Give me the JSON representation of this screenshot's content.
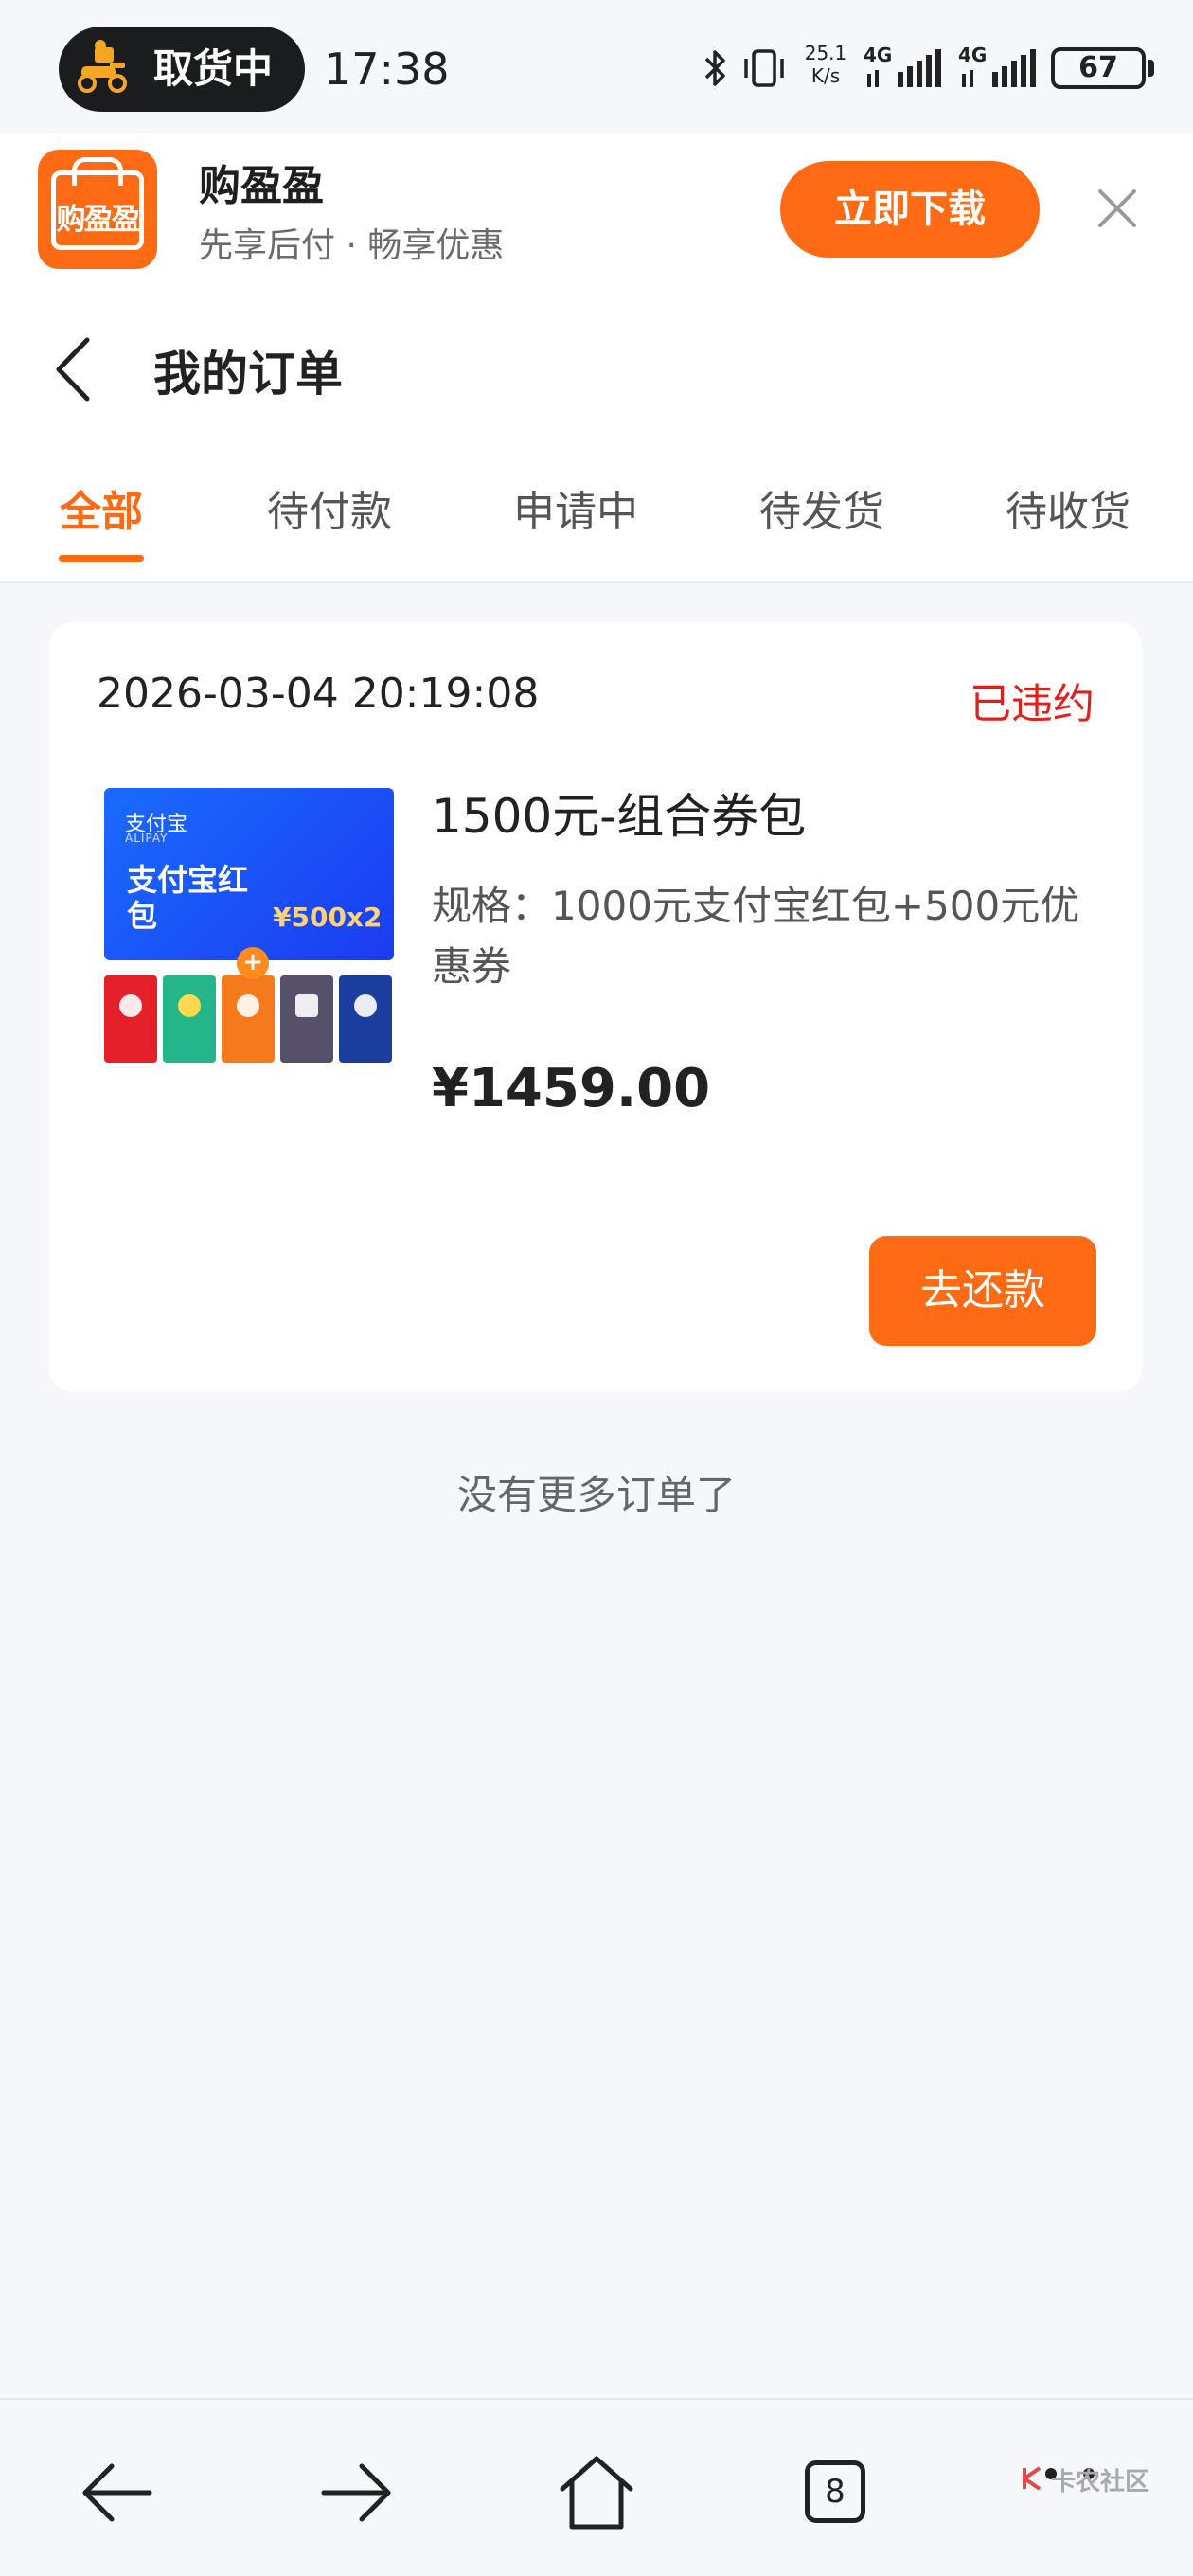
{
  "status_bar": {
    "pill_text": "取货中",
    "time": "17:38",
    "net_speed_value": "25.1",
    "net_speed_unit": "K/s",
    "signal_1_label": "4G",
    "signal_2_label": "4G",
    "battery_level": "67"
  },
  "promo": {
    "logo_text": "购盈盈",
    "app_name": "购盈盈",
    "slogan": "先享后付 · 畅享优惠",
    "download_label": "立即下载"
  },
  "header": {
    "title": "我的订单"
  },
  "tabs": [
    {
      "label": "全部",
      "active": true
    },
    {
      "label": "待付款",
      "active": false
    },
    {
      "label": "申请中",
      "active": false
    },
    {
      "label": "待发货",
      "active": false
    },
    {
      "label": "待收货",
      "active": false
    }
  ],
  "order": {
    "time": "2026-03-04 20:19:08",
    "status": "已违约",
    "thumbnail": {
      "brand": "支付宝",
      "brand_sub": "ALIPAY",
      "title": "支付宝红包",
      "amount": "¥500x2",
      "plus": "+"
    },
    "product_name": "1500元-组合券包",
    "spec": "规格：1000元支付宝红包+500元优惠券",
    "price": "¥1459.00",
    "action_label": "去还款"
  },
  "no_more_text": "没有更多订单了",
  "bottom_bar": {
    "tab_count": "8"
  },
  "watermark": "卡农社区",
  "colors": {
    "accent": "#ff6a14",
    "status_violation": "#e0201c",
    "background": "#f6f7fb"
  }
}
